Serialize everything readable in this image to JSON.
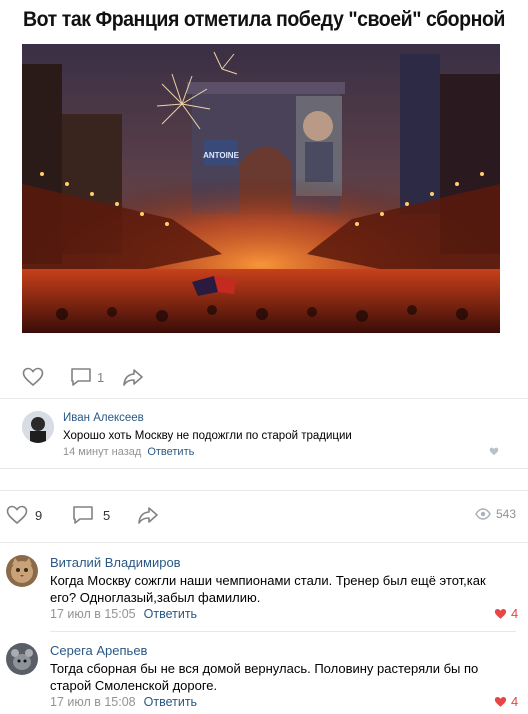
{
  "meme": {
    "headline": "Вот так Франция отметила победу \"своей\" сборной"
  },
  "photo": {
    "description_icon": "paris-celebration-photo",
    "banner_text": "ANTOINE"
  },
  "inner_post": {
    "like_icon": "heart-outline-icon",
    "comment_icon": "comment-icon",
    "comment_count": "1",
    "share_icon": "share-arrow-icon",
    "comment": {
      "author": "Иван Алексеев",
      "text": "Хорошо хоть Москву не подожгли по старой традиции",
      "time": "14 минут назад",
      "reply_label": "Ответить",
      "like_icon": "heart-small-icon"
    }
  },
  "post_actions": {
    "likes": "9",
    "comments": "5",
    "views": "543",
    "views_icon": "eye-icon"
  },
  "comments": [
    {
      "author": "Виталий Владимиров",
      "text_line1": "Когда Москву сожгли наши чемпионами стали. Тренер был ещё этот,как",
      "text_line2": "его? Одноглазый,забыл фамилию.",
      "time": "17 июл в 15:05",
      "reply_label": "Ответить",
      "likes": "4"
    },
    {
      "author": "Серега Арепьев",
      "text_line1": "Тогда сборная бы не вся домой вернулась. Половину растеряли бы по",
      "text_line2": "старой Смоленской дороге.",
      "time": "17 июл в 15:08",
      "reply_label": "Ответить",
      "likes": "4"
    }
  ],
  "colors": {
    "link": "#2a5885",
    "meta": "#939393",
    "like_red": "#e64646",
    "icon_gray": "#828282"
  }
}
